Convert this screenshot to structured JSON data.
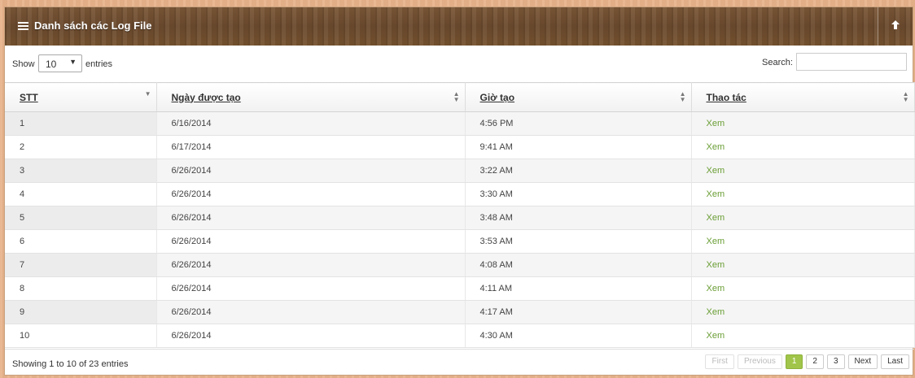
{
  "panel": {
    "title": "Danh sách các Log File"
  },
  "toolbar": {
    "show_label": "Show",
    "length_value": "10",
    "entries_label": "entries",
    "search_label": "Search:",
    "search_value": ""
  },
  "table": {
    "columns": [
      "STT",
      "Ngày được tạo",
      "Giờ tạo",
      "Thao tác"
    ],
    "rows": [
      [
        "1",
        "6/16/2014",
        "4:56 PM",
        "Xem"
      ],
      [
        "2",
        "6/17/2014",
        "9:41 AM",
        "Xem"
      ],
      [
        "3",
        "6/26/2014",
        "3:22 AM",
        "Xem"
      ],
      [
        "4",
        "6/26/2014",
        "3:30 AM",
        "Xem"
      ],
      [
        "5",
        "6/26/2014",
        "3:48 AM",
        "Xem"
      ],
      [
        "6",
        "6/26/2014",
        "3:53 AM",
        "Xem"
      ],
      [
        "7",
        "6/26/2014",
        "4:08 AM",
        "Xem"
      ],
      [
        "8",
        "6/26/2014",
        "4:11 AM",
        "Xem"
      ],
      [
        "9",
        "6/26/2014",
        "4:17 AM",
        "Xem"
      ],
      [
        "10",
        "6/26/2014",
        "4:30 AM",
        "Xem"
      ]
    ]
  },
  "footer": {
    "info": "Showing 1 to 10 of 23 entries",
    "pager": {
      "first": "First",
      "previous": "Previous",
      "pages": [
        "1",
        "2",
        "3"
      ],
      "current": "1",
      "next": "Next",
      "last": "Last"
    }
  },
  "colors": {
    "accent": "#a0c54a",
    "link": "#6a9e35",
    "header_wood": "#6b4a2e"
  },
  "icons": {
    "menu": "menu-icon",
    "up": "arrow-up-icon"
  }
}
